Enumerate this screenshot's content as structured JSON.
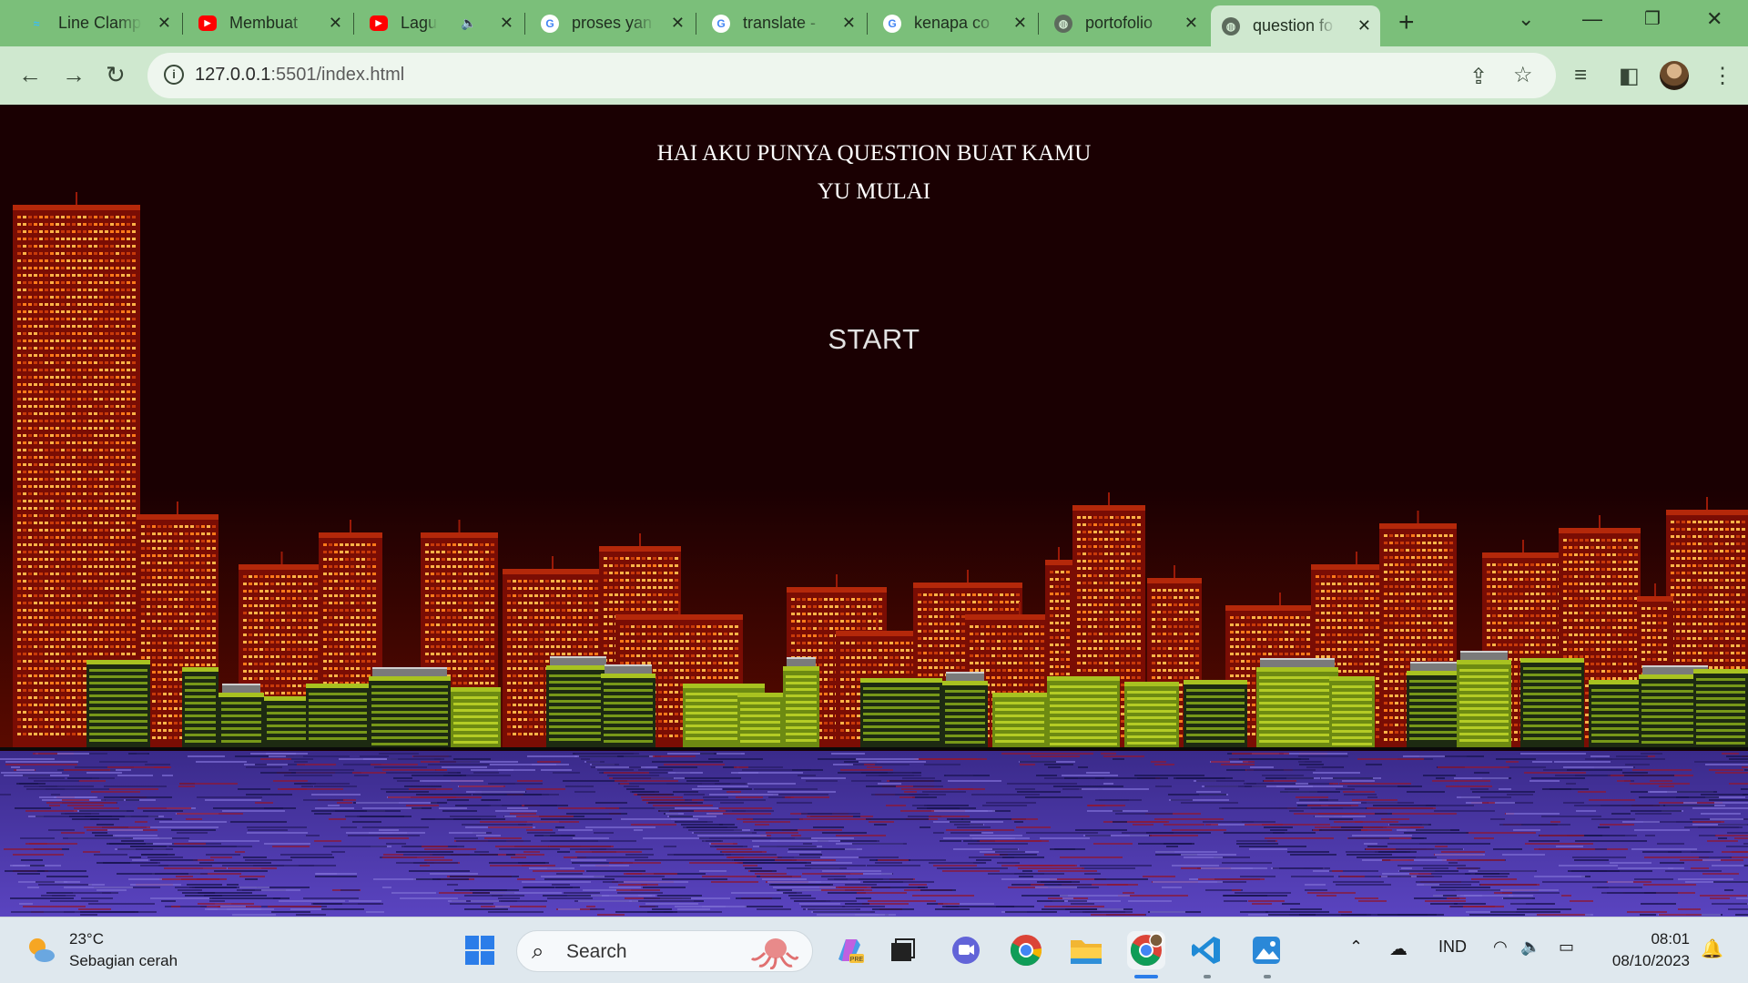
{
  "browser": {
    "tabs": [
      {
        "title": "Line Clamp",
        "icon": "tailwind-icon",
        "active": false
      },
      {
        "title": "Membuat",
        "icon": "youtube-icon",
        "active": false
      },
      {
        "title": "Lagu l",
        "icon": "youtube-icon",
        "active": false,
        "audio": true
      },
      {
        "title": "proses yan",
        "icon": "google-icon",
        "active": false
      },
      {
        "title": "translate -",
        "icon": "google-icon",
        "active": false
      },
      {
        "title": "kenapa co",
        "icon": "google-icon",
        "active": false
      },
      {
        "title": "portofolio",
        "icon": "globe-icon",
        "active": false
      },
      {
        "title": "question fo",
        "icon": "globe-icon",
        "active": true
      }
    ],
    "url_host": "127.0.0.1",
    "url_rest": ":5501/index.html"
  },
  "page": {
    "heading_line1": "HAI AKU PUNYA QUESTION BUAT KAMU",
    "heading_line2": "YU MULAI",
    "start_label": "START"
  },
  "taskbar": {
    "weather_temp": "23°C",
    "weather_desc": "Sebagian cerah",
    "search_label": "Search",
    "language": "IND",
    "time": "08:01",
    "date": "08/10/2023"
  },
  "colors": {
    "browser_frame": "#7bbf7a",
    "page_background": "#1a0002",
    "water": "#4f3aa8"
  }
}
